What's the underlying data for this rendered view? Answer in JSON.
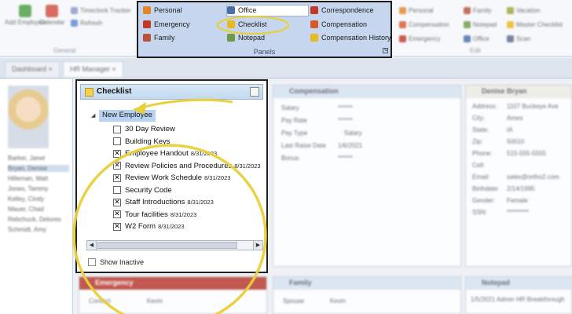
{
  "ribbon": {
    "buttons": [
      {
        "label": "Add Employee",
        "icon": "add-employee-icon"
      },
      {
        "label": "Calendar",
        "icon": "calendar-icon"
      }
    ],
    "misc_items": [
      {
        "label": "Timeclock Tracker",
        "icon": "timeclock-icon"
      },
      {
        "label": "Refresh",
        "icon": "refresh-icon"
      }
    ],
    "general_group_label": "General",
    "panels": {
      "items": [
        {
          "label": "Personal",
          "icon": "personal-icon",
          "color": "#e0872c"
        },
        {
          "label": "Office",
          "icon": "office-icon",
          "color": "#4a6ea8"
        },
        {
          "label": "Correspondence",
          "icon": "correspondence-icon",
          "color": "#c0392b"
        },
        {
          "label": "Emergency",
          "icon": "emergency-icon",
          "color": "#c0392b"
        },
        {
          "label": "Checklist",
          "icon": "checklist-icon",
          "color": "#e7b923"
        },
        {
          "label": "Compensation",
          "icon": "compensation-icon",
          "color": "#d45a2a"
        },
        {
          "label": "Family",
          "icon": "family-icon",
          "color": "#b8523c"
        },
        {
          "label": "Notepad",
          "icon": "notepad-icon",
          "color": "#6f9a45"
        },
        {
          "label": "Compensation History",
          "icon": "compensation-history-icon",
          "color": "#e7b923"
        }
      ],
      "group_label": "Panels"
    },
    "right_items": [
      "Personal",
      "Family",
      "Vacation",
      "Compensation",
      "Notepad",
      "Master Checklist",
      "Emergency",
      "Office",
      "Scan"
    ],
    "edit_group_label": "Edit"
  },
  "tabs": [
    {
      "label": "Dashboard"
    },
    {
      "label": "HR Manager"
    }
  ],
  "employees": [
    "Barker, Janet",
    "Bryan, Denise",
    "Hilleman, Matt",
    "Jones, Tammy",
    "Kelley, Cindy",
    "Mauer, Chad",
    "Rebchuck, Delores",
    "Schmidt, Amy"
  ],
  "compensation": {
    "title": "Compensation",
    "fields": [
      {
        "k": "Salary",
        "v": "******"
      },
      {
        "k": "Pay Rate",
        "v": "******"
      },
      {
        "k": "Pay Type",
        "v": "Salary"
      },
      {
        "k": "Last Raise Date",
        "v": "1/6/2021"
      },
      {
        "k": "Bonus",
        "v": "******"
      }
    ]
  },
  "person": {
    "title": "Denise Bryan",
    "fields": [
      {
        "k": "Address:",
        "v": "1107 Buckeye Ave"
      },
      {
        "k": "City:",
        "v": "Ames"
      },
      {
        "k": "State:",
        "v": "IA"
      },
      {
        "k": "Zip:",
        "v": "50010"
      },
      {
        "k": "Phone:",
        "v": "515-555-5555"
      },
      {
        "k": "Cell:",
        "v": ""
      },
      {
        "k": "Email:",
        "v": "sales@ortho2.com"
      },
      {
        "k": "Birthdate:",
        "v": "2/14/1995"
      },
      {
        "k": "Gender:",
        "v": "Female"
      },
      {
        "k": "SSN:",
        "v": "*********"
      }
    ]
  },
  "checklist": {
    "title": "Checklist",
    "root": "New Employee",
    "items": [
      {
        "name": "30 Day Review",
        "checked": false,
        "date": ""
      },
      {
        "name": "Building Keys",
        "checked": false,
        "date": ""
      },
      {
        "name": "Employee Handout",
        "checked": true,
        "date": "8/31/2023"
      },
      {
        "name": "Review Policies and Procedures",
        "checked": true,
        "date": "8/31/2023"
      },
      {
        "name": "Review Work Schedule",
        "checked": true,
        "date": "8/31/2023"
      },
      {
        "name": "Security Code",
        "checked": false,
        "date": ""
      },
      {
        "name": "Staff Introductions",
        "checked": true,
        "date": "8/31/2023"
      },
      {
        "name": "Tour facilities",
        "checked": true,
        "date": "8/31/2023"
      },
      {
        "name": "W2 Form",
        "checked": true,
        "date": "8/31/2023"
      }
    ],
    "show_inactive_label": "Show Inactive",
    "check_mark": "✕"
  },
  "bottom_cards": {
    "emergency": {
      "title": "Emergency",
      "k": "Contact",
      "v": "Kevin"
    },
    "family": {
      "title": "Family",
      "k": "Spouse",
      "v": "Kevin"
    },
    "notepad": {
      "title": "Notepad",
      "text": "1/5/2021 Admin HR Breakthrough"
    }
  },
  "colors": {
    "highlight_circle": "#e9cf3c",
    "panel_bg": "#c5d6ee",
    "selection": "#b7d3f1"
  }
}
